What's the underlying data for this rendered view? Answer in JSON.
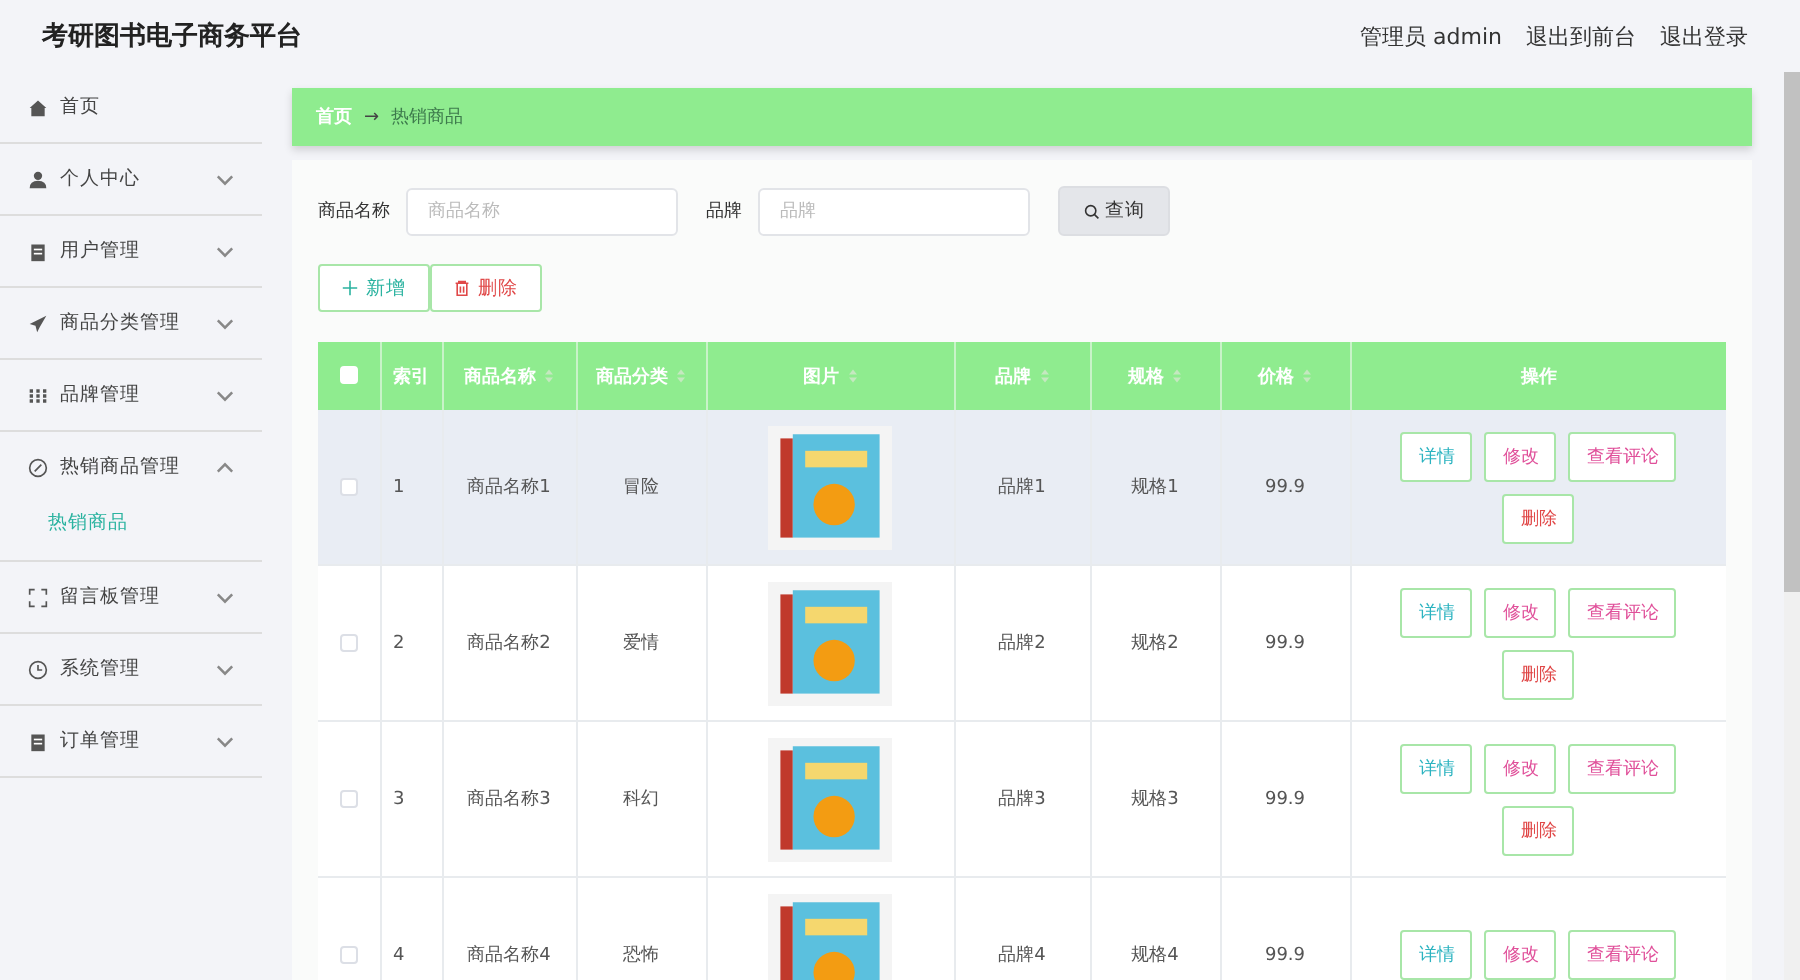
{
  "header": {
    "title": "考研图书电子商务平台",
    "links": [
      "管理员 admin",
      "退出到前台",
      "退出登录"
    ]
  },
  "sidebar": {
    "items": [
      {
        "label": "首页"
      },
      {
        "label": "个人中心",
        "expanded": false
      },
      {
        "label": "用户管理",
        "expanded": false
      },
      {
        "label": "商品分类管理",
        "expanded": false
      },
      {
        "label": "品牌管理",
        "expanded": false
      },
      {
        "label": "热销商品管理",
        "expanded": true,
        "children": [
          {
            "label": "热销商品",
            "selected": true
          }
        ]
      },
      {
        "label": "留言板管理",
        "expanded": false
      },
      {
        "label": "系统管理",
        "expanded": false
      },
      {
        "label": "订单管理",
        "expanded": false
      }
    ]
  },
  "breadcrumb": {
    "home": "首页",
    "arrow": "→",
    "current": "热销商品"
  },
  "search": {
    "fields": [
      {
        "label": "商品名称",
        "placeholder": "商品名称"
      },
      {
        "label": "品牌",
        "placeholder": "品牌"
      }
    ],
    "button": "查询"
  },
  "toolbar": [
    {
      "label": "新增",
      "kind": "add"
    },
    {
      "label": "删除",
      "kind": "delete"
    }
  ],
  "table": {
    "select_all": {
      "checked": false
    },
    "columns": [
      {
        "label": "索引",
        "sortable": false
      },
      {
        "label": "商品名称",
        "sortable": true
      },
      {
        "label": "商品分类",
        "sortable": true
      },
      {
        "label": "图片",
        "sortable": true
      },
      {
        "label": "品牌",
        "sortable": true
      },
      {
        "label": "规格",
        "sortable": true
      },
      {
        "label": "价格",
        "sortable": true
      },
      {
        "label": "操作",
        "sortable": false
      }
    ],
    "rows": [
      {
        "checked": false,
        "highlighted": true,
        "index": "1",
        "name": "商品名称1",
        "category": "冒险",
        "brand": "品牌1",
        "spec": "规格1",
        "price": "99.9",
        "actions": [
          {
            "label": "详情",
            "kind": "info"
          },
          {
            "label": "修改",
            "kind": "edit"
          },
          {
            "label": "查看评论",
            "kind": "edit"
          },
          {
            "label": "删除",
            "kind": "delete"
          }
        ]
      },
      {
        "checked": false,
        "highlighted": false,
        "index": "2",
        "name": "商品名称2",
        "category": "爱情",
        "brand": "品牌2",
        "spec": "规格2",
        "price": "99.9",
        "actions": [
          {
            "label": "详情",
            "kind": "info"
          },
          {
            "label": "修改",
            "kind": "edit"
          },
          {
            "label": "查看评论",
            "kind": "edit"
          },
          {
            "label": "删除",
            "kind": "delete"
          }
        ]
      },
      {
        "checked": false,
        "highlighted": false,
        "index": "3",
        "name": "商品名称3",
        "category": "科幻",
        "brand": "品牌3",
        "spec": "规格3",
        "price": "99.9",
        "actions": [
          {
            "label": "详情",
            "kind": "info"
          },
          {
            "label": "修改",
            "kind": "edit"
          },
          {
            "label": "查看评论",
            "kind": "edit"
          },
          {
            "label": "删除",
            "kind": "delete"
          }
        ]
      },
      {
        "checked": false,
        "highlighted": false,
        "index": "4",
        "name": "商品名称4",
        "category": "恐怖",
        "brand": "品牌4",
        "spec": "规格4",
        "price": "99.9",
        "actions": [
          {
            "label": "详情",
            "kind": "info"
          },
          {
            "label": "修改",
            "kind": "edit"
          },
          {
            "label": "查看评论",
            "kind": "edit"
          }
        ]
      }
    ]
  }
}
